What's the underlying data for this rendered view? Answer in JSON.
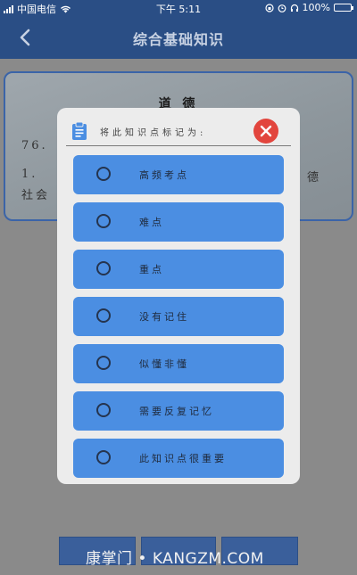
{
  "status_bar": {
    "carrier": "中国电信",
    "time": "下午 5:11",
    "battery": "100%"
  },
  "nav": {
    "title": "综合基础知识",
    "back_icon": "chevron-left-icon"
  },
  "background": {
    "card_title": "道 德",
    "line1": "76.",
    "line2_start": "1.",
    "line2_end": "德",
    "line3": "社会"
  },
  "dialog": {
    "title": "将此知识点标记为:",
    "header_icon": "clipboard-icon",
    "close_icon": "close-icon",
    "options": [
      {
        "label": "高频考点"
      },
      {
        "label": "难点"
      },
      {
        "label": "重点"
      },
      {
        "label": "没有记住"
      },
      {
        "label": "似懂非懂"
      },
      {
        "label": "需要反复记忆"
      },
      {
        "label": "此知识点很重要"
      }
    ]
  },
  "watermark": "康掌门 • KANGZM.COM",
  "colors": {
    "primary": "#2a4e85",
    "option_bg": "#4b8ee2",
    "close_red": "#e2453d",
    "dialog_bg": "#ececec"
  }
}
